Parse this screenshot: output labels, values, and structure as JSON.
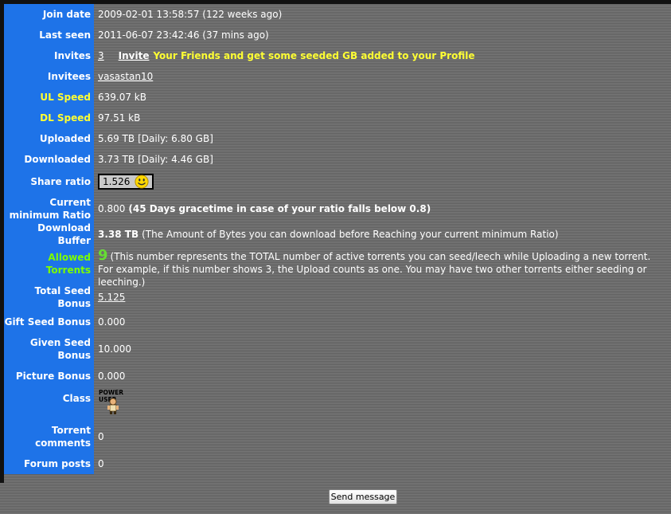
{
  "rows": {
    "join_date": {
      "label": "Join date",
      "value": "2009-02-01 13:58:57 (122 weeks ago)"
    },
    "last_seen": {
      "label": "Last seen",
      "value": "2011-06-07 23:42:46 (37 mins ago)"
    },
    "invites": {
      "label": "Invites",
      "count": "3",
      "link": "Invite",
      "promo": "Your Friends and get some seeded GB added to your Profile"
    },
    "invitees": {
      "label": "Invitees",
      "value": "vasastan10"
    },
    "ul_speed": {
      "label": "UL Speed",
      "value": "639.07 kB"
    },
    "dl_speed": {
      "label": "DL Speed",
      "value": "97.51 kB"
    },
    "uploaded": {
      "label": "Uploaded",
      "value": "5.69 TB",
      "daily": "[Daily: 6.80 GB]"
    },
    "downloaded": {
      "label": "Downloaded",
      "value": "3.73 TB",
      "daily": "[Daily: 4.46 GB]"
    },
    "share_ratio": {
      "label": "Share ratio",
      "value": "1.526",
      "icon": "smiley-icon"
    },
    "min_ratio": {
      "label_line1": "Current",
      "label_line2": "minimum Ratio",
      "value": "0.800",
      "note": "(45 Days gracetime in case of your ratio falls below 0.8)"
    },
    "download_buffer": {
      "label": "Download Buffer",
      "value": "3.38 TB",
      "note": "(The Amount of Bytes you can download before Reaching your current minimum Ratio)"
    },
    "allowed_torrents": {
      "label": "Allowed Torrents",
      "value": "9",
      "note_line1": "(This number represents the TOTAL number of active torrents you can seed/leech while Uploading a new torrent.",
      "note_line2": "For example, if this number shows 3, the Upload counts as one. You may have two other torrents either seeding or leeching.)"
    },
    "total_seed_bonus": {
      "label_line1": "Total Seed",
      "label_line2": "Bonus",
      "value": "5.125"
    },
    "gift_seed_bonus": {
      "label": "Gift Seed Bonus",
      "value": "0.000"
    },
    "given_seed_bonus": {
      "label_line1": "Given Seed",
      "label_line2": "Bonus",
      "value": "10.000"
    },
    "picture_bonus": {
      "label": "Picture Bonus",
      "value": "0.000"
    },
    "class": {
      "label": "Class",
      "badge_text": "POWER USER",
      "icon": "power-user-icon"
    },
    "torrent_comments": {
      "label_line1": "Torrent",
      "label_line2": "comments",
      "value": "0"
    },
    "forum_posts": {
      "label": "Forum posts",
      "value": "0"
    }
  },
  "send_message": {
    "label": "Send message"
  },
  "colors": {
    "label_bg": "#1e73e8",
    "highlight": "#ffff33",
    "green_label": "#7cfc00",
    "big_number": "#66dd33"
  }
}
